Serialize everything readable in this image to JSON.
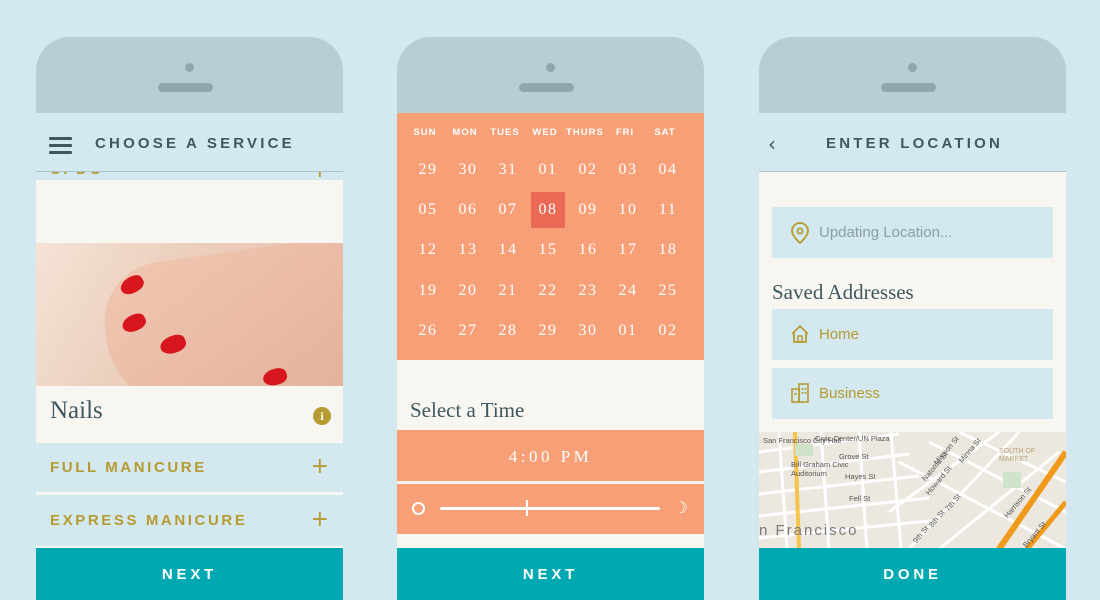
{
  "phone1": {
    "header_title": "CHOOSE A SERVICE",
    "partial_row": "UPDO",
    "section_title": "Nails",
    "services": [
      "FULL MANICURE",
      "EXPRESS MANICURE"
    ],
    "info_glyph": "i",
    "next_label": "NEXT",
    "icons": [
      "hamburger-menu-icon",
      "plus-icon",
      "info-icon"
    ]
  },
  "phone2": {
    "weekdays": [
      "SUN",
      "MON",
      "TUES",
      "WED",
      "THURS",
      "FRI",
      "SAT"
    ],
    "weeks": [
      [
        "29",
        "30",
        "31",
        "01",
        "02",
        "03",
        "04"
      ],
      [
        "05",
        "06",
        "07",
        "08",
        "09",
        "10",
        "11"
      ],
      [
        "12",
        "13",
        "14",
        "15",
        "16",
        "17",
        "18"
      ],
      [
        "19",
        "20",
        "21",
        "22",
        "23",
        "24",
        "25"
      ],
      [
        "26",
        "27",
        "28",
        "29",
        "30",
        "01",
        "02"
      ]
    ],
    "selected_day": "08",
    "time_title": "Select a Time",
    "time_value": "4:00 PM",
    "time_slider_fraction": 0.39,
    "next_label": "NEXT",
    "icons": [
      "sun-icon",
      "moon-icon"
    ]
  },
  "phone3": {
    "header_title": "ENTER LOCATION",
    "location_placeholder": "Updating Location...",
    "saved_title": "Saved Addresses",
    "addresses": [
      "Home",
      "Business"
    ],
    "map_labels": {
      "city_hall": "San Francisco City Hall",
      "civic_center": "Civic Center/UN Plaza",
      "bill_graham": "Bill Graham Civic Auditorium",
      "grove": "Grove St",
      "hayes": "Hayes St",
      "fell": "Fell St",
      "mission": "Mission St",
      "minna": "Minna St",
      "natoma": "Natoma St",
      "howard": "Howard St",
      "seventh": "7th St",
      "eighth": "8th St",
      "ninth": "9th St",
      "harrison": "Harrison St",
      "bryant": "Bryant St",
      "south_market": "SOUTH OF MARKET",
      "city": "n Francisco"
    },
    "done_label": "DONE",
    "icons": [
      "back-chevron-icon",
      "location-pin-icon",
      "home-icon",
      "building-icon"
    ]
  },
  "colors": {
    "background": "#d4e9ef",
    "phone_shell": "#b8ced5",
    "teal_button": "#00a9b2",
    "peach": "#f7a077",
    "selected_day": "#ea6a55",
    "gold": "#b69a32",
    "dark_text": "#3f5860"
  }
}
